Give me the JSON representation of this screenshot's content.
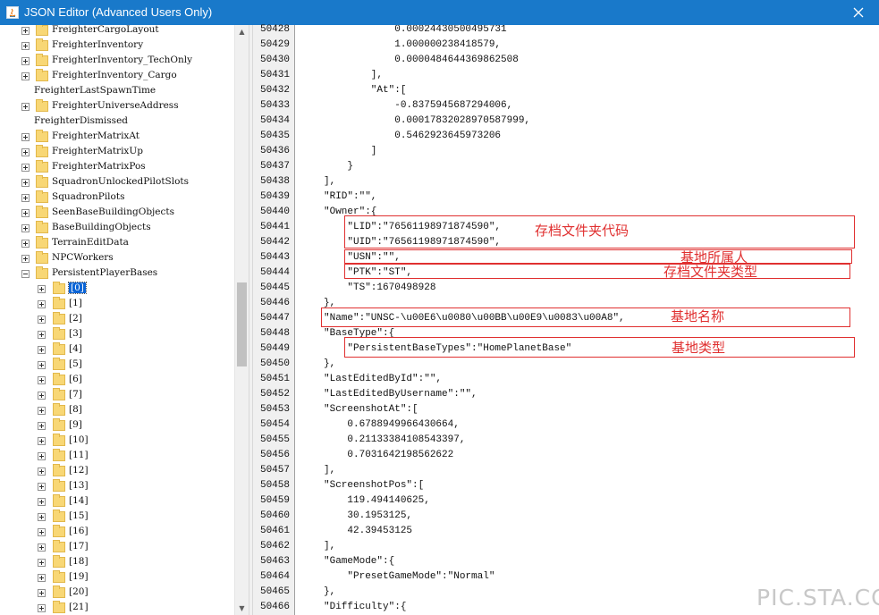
{
  "window": {
    "title": "JSON Editor (Advanced Users Only)",
    "close_icon": "close-icon",
    "accent_color": "#1979ca"
  },
  "tree": {
    "items": [
      {
        "label": "FreighterCargoLayout",
        "folder": true,
        "expander": "plus"
      },
      {
        "label": "FreighterInventory",
        "folder": true,
        "expander": "plus"
      },
      {
        "label": "FreighterInventory_TechOnly",
        "folder": true,
        "expander": "plus"
      },
      {
        "label": "FreighterInventory_Cargo",
        "folder": true,
        "expander": "plus"
      },
      {
        "label": "FreighterLastSpawnTime",
        "folder": false,
        "expander": "none"
      },
      {
        "label": "FreighterUniverseAddress",
        "folder": true,
        "expander": "plus"
      },
      {
        "label": "FreighterDismissed",
        "folder": false,
        "expander": "none"
      },
      {
        "label": "FreighterMatrixAt",
        "folder": true,
        "expander": "plus"
      },
      {
        "label": "FreighterMatrixUp",
        "folder": true,
        "expander": "plus"
      },
      {
        "label": "FreighterMatrixPos",
        "folder": true,
        "expander": "plus"
      },
      {
        "label": "SquadronUnlockedPilotSlots",
        "folder": true,
        "expander": "plus"
      },
      {
        "label": "SquadronPilots",
        "folder": true,
        "expander": "plus"
      },
      {
        "label": "SeenBaseBuildingObjects",
        "folder": true,
        "expander": "plus"
      },
      {
        "label": "BaseBuildingObjects",
        "folder": true,
        "expander": "plus"
      },
      {
        "label": "TerrainEditData",
        "folder": true,
        "expander": "plus"
      },
      {
        "label": "NPCWorkers",
        "folder": true,
        "expander": "plus"
      },
      {
        "label": "PersistentPlayerBases",
        "folder": true,
        "expander": "minus"
      }
    ],
    "children": [
      "[0]",
      "[1]",
      "[2]",
      "[3]",
      "[4]",
      "[5]",
      "[6]",
      "[7]",
      "[8]",
      "[9]",
      "[10]",
      "[11]",
      "[12]",
      "[13]",
      "[14]",
      "[15]",
      "[16]",
      "[17]",
      "[18]",
      "[19]",
      "[20]",
      "[21]"
    ],
    "selected_child": "[0]"
  },
  "scrollbar": {
    "up_icon": "scroll-up-icon",
    "down_icon": "scroll-down-icon"
  },
  "editor": {
    "lines": [
      {
        "num": "50428",
        "text": "            0.00024430500495731"
      },
      {
        "num": "50429",
        "text": "            1.000000238418579,"
      },
      {
        "num": "50430",
        "text": "            0.0000484644369862508"
      },
      {
        "num": "50431",
        "text": "        ],"
      },
      {
        "num": "50432",
        "text": "        \"At\":["
      },
      {
        "num": "50433",
        "text": "            -0.8375945687294006,"
      },
      {
        "num": "50434",
        "text": "            0.00017832028970587999,"
      },
      {
        "num": "50435",
        "text": "            0.5462923645973206"
      },
      {
        "num": "50436",
        "text": "        ]"
      },
      {
        "num": "50437",
        "text": "    }"
      },
      {
        "num": "50438",
        "text": "],"
      },
      {
        "num": "50439",
        "text": "\"RID\":\"\","
      },
      {
        "num": "50440",
        "text": "\"Owner\":{"
      },
      {
        "num": "50441",
        "text": "    \"LID\":\"76561198971874590\","
      },
      {
        "num": "50442",
        "text": "    \"UID\":\"76561198971874590\","
      },
      {
        "num": "50443",
        "text": "    \"USN\":\"\","
      },
      {
        "num": "50444",
        "text": "    \"PTK\":\"ST\","
      },
      {
        "num": "50445",
        "text": "    \"TS\":1670498928"
      },
      {
        "num": "50446",
        "text": "},"
      },
      {
        "num": "50447",
        "text": "\"Name\":\"UNSC-\\u00E6\\u0080\\u00BB\\u00E9\\u0083\\u00A8\","
      },
      {
        "num": "50448",
        "text": "\"BaseType\":{"
      },
      {
        "num": "50449",
        "text": "    \"PersistentBaseTypes\":\"HomePlanetBase\""
      },
      {
        "num": "50450",
        "text": "},"
      },
      {
        "num": "50451",
        "text": "\"LastEditedById\":\"\","
      },
      {
        "num": "50452",
        "text": "\"LastEditedByUsername\":\"\","
      },
      {
        "num": "50453",
        "text": "\"ScreenshotAt\":["
      },
      {
        "num": "50454",
        "text": "    0.6788949966430664,"
      },
      {
        "num": "50455",
        "text": "    0.21133384108543397,"
      },
      {
        "num": "50456",
        "text": "    0.7031642198562622"
      },
      {
        "num": "50457",
        "text": "],"
      },
      {
        "num": "50458",
        "text": "\"ScreenshotPos\":["
      },
      {
        "num": "50459",
        "text": "    119.494140625,"
      },
      {
        "num": "50460",
        "text": "    30.1953125,"
      },
      {
        "num": "50461",
        "text": "    42.39453125"
      },
      {
        "num": "50462",
        "text": "],"
      },
      {
        "num": "50463",
        "text": "\"GameMode\":{"
      },
      {
        "num": "50464",
        "text": "    \"PresetGameMode\":\"Normal\""
      },
      {
        "num": "50465",
        "text": "},"
      },
      {
        "num": "50466",
        "text": "\"Difficulty\":{"
      }
    ]
  },
  "annotations": [
    {
      "label": "存档文件夹代码"
    },
    {
      "label": "基地所属人"
    },
    {
      "label": "存档文件夹类型"
    },
    {
      "label": "基地名称"
    },
    {
      "label": "基地类型"
    }
  ],
  "annotation_color": "#e03030",
  "watermark": {
    "text": "PIC.STA.CC"
  }
}
